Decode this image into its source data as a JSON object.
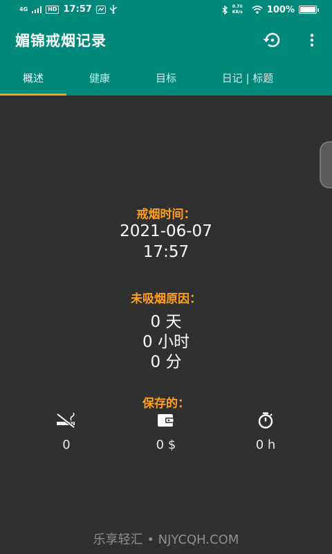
{
  "status_bar": {
    "network": "4G",
    "hd_badge": "HD",
    "time": "17:57",
    "speed": "0.70 KB/s",
    "battery": "100%",
    "battery_level": 1.0
  },
  "app_bar": {
    "title": "媚锦戒烟记录"
  },
  "tabs": [
    {
      "label": "概述",
      "active": true
    },
    {
      "label": "健康",
      "active": false
    },
    {
      "label": "目标",
      "active": false
    },
    {
      "label": "日记 | 标题",
      "active": false
    }
  ],
  "overview": {
    "quit_time_label": "戒烟时间：",
    "quit_date": "2021-06-07",
    "quit_clock": "17:57",
    "not_smoked_label": "未吸烟原因：",
    "days": "0 天",
    "hours": "0 小时",
    "minutes": "0 分",
    "saved_label": "保存的：",
    "saved_cigarettes": "0",
    "saved_money": "0 $",
    "saved_time": "0 h"
  },
  "watermark": "乐享轻汇 • NJYCQH.COM",
  "colors": {
    "primary": "#00897b",
    "accent": "#ffa000",
    "label": "#ff9f1a",
    "background": "#303030"
  }
}
